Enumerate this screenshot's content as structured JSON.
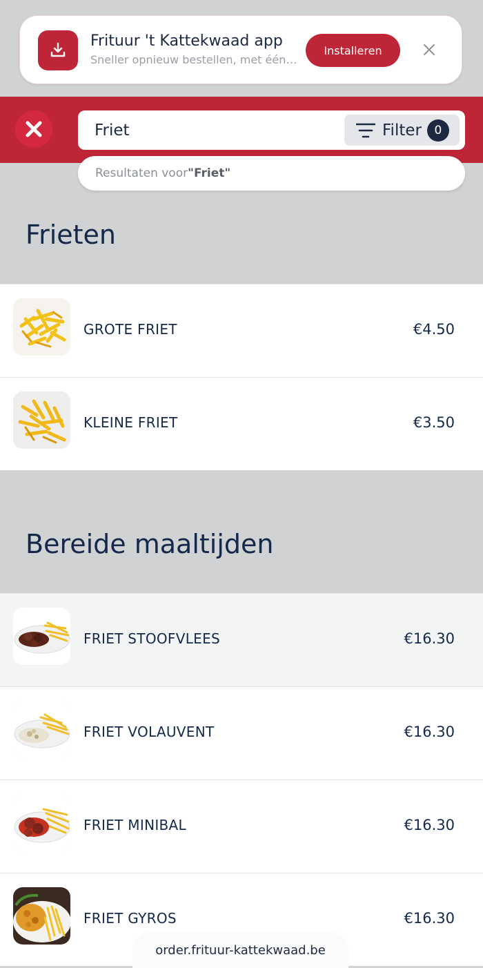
{
  "install_banner": {
    "title": "Frituur 't Kattekwaad app",
    "subtitle": "Sneller opnieuw bestellen, met één klik",
    "install_label": "Installeren",
    "accent_color": "#be2638"
  },
  "search": {
    "value": "Friet",
    "filter_label": "Filter",
    "filter_count": "0",
    "results_prefix": "Resultaten voor ",
    "results_query": "\"Friet\""
  },
  "sections": [
    {
      "title": "Frieten",
      "items": [
        {
          "name": "GROTE FRIET",
          "price": "€4.50",
          "icon": "fries-image"
        },
        {
          "name": "KLEINE FRIET",
          "price": "€3.50",
          "icon": "fries-image"
        }
      ]
    },
    {
      "title": "Bereide maaltijden",
      "items": [
        {
          "name": "FRIET STOOFVLEES",
          "price": "€16.30",
          "icon": "stew-plate-image"
        },
        {
          "name": "FRIET VOLAUVENT",
          "price": "€16.30",
          "icon": "volauvent-plate-image"
        },
        {
          "name": "FRIET MINIBAL",
          "price": "€16.30",
          "icon": "meatballs-plate-image"
        },
        {
          "name": "FRIET GYROS",
          "price": "€16.30",
          "icon": "gyros-plate-image"
        }
      ]
    }
  ],
  "browser": {
    "url": "order.frituur-kattekwaad.be"
  }
}
